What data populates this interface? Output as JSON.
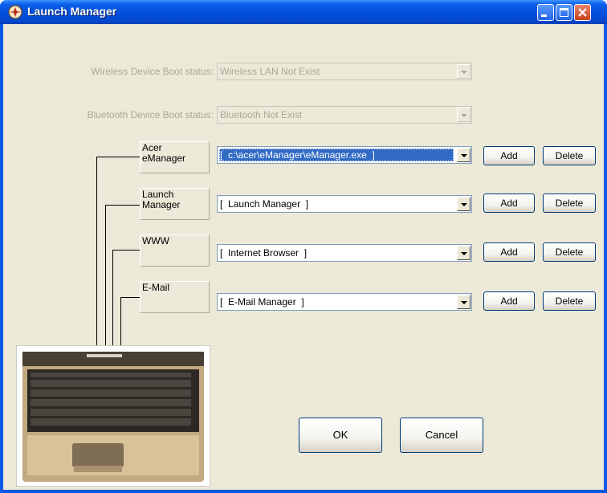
{
  "window": {
    "title": "Launch Manager"
  },
  "wireless": {
    "label": "Wireless Device Boot status:",
    "value": "Wireless LAN Not Exist"
  },
  "bluetooth": {
    "label": "Bluetooth Device Boot status:",
    "value": "Bluetooth Not Exist"
  },
  "keys": [
    {
      "label_line1": "Acer",
      "label_line2": "eManager",
      "value": "[  c:\\acer\\eManager\\eManager.exe  ]",
      "add": "Add",
      "delete": "Delete"
    },
    {
      "label_line1": "Launch",
      "label_line2": "Manager",
      "value": "[  Launch Manager  ]",
      "add": "Add",
      "delete": "Delete"
    },
    {
      "label_line1": "WWW",
      "label_line2": "",
      "value": "[  Internet Browser  ]",
      "add": "Add",
      "delete": "Delete"
    },
    {
      "label_line1": "E-Mail",
      "label_line2": "",
      "value": "[  E-Mail Manager  ]",
      "add": "Add",
      "delete": "Delete"
    }
  ],
  "buttons": {
    "ok": "OK",
    "cancel": "Cancel"
  },
  "icons": {
    "app": "acer-launch-icon",
    "minimize": "minimize-icon",
    "maximize": "maximize-icon",
    "close": "close-icon"
  },
  "colors": {
    "titlebar": "#0550dc",
    "dialog_bg": "#ece9d8",
    "selection": "#316ac5"
  }
}
